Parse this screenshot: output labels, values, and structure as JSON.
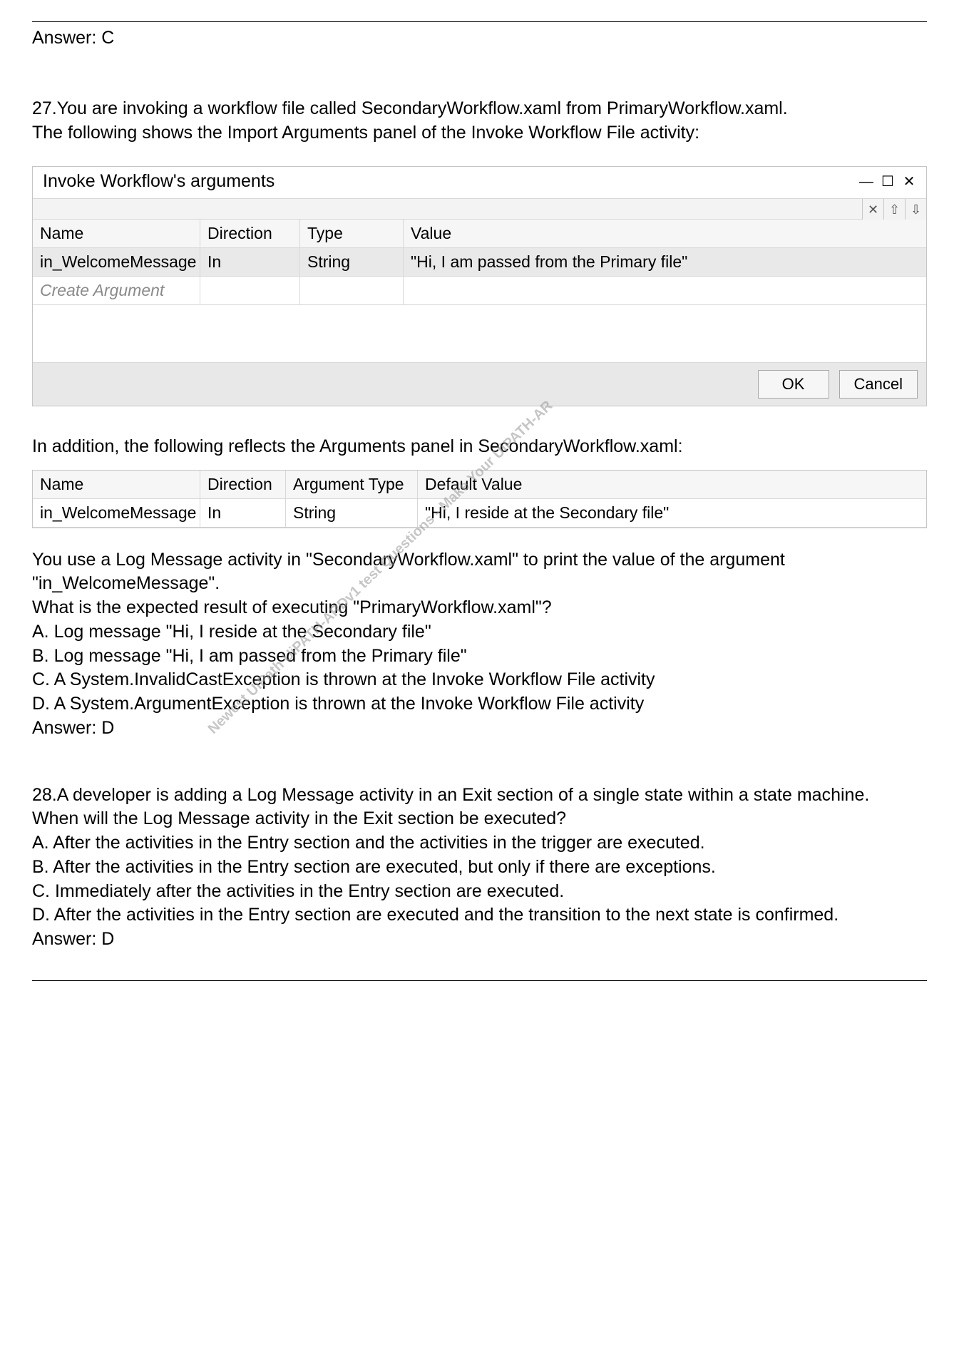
{
  "prev_answer": "Answer: C",
  "q27": {
    "intro1": "27.You are invoking a workflow file called SecondaryWorkflow.xaml from PrimaryWorkflow.xaml.",
    "intro2": "The following shows the Import Arguments panel of the Invoke Workflow File activity:",
    "dialog_title": "Invoke Workflow's arguments",
    "header_name": "Name",
    "header_dir": "Direction",
    "header_type": "Type",
    "header_value": "Value",
    "row1_name": "in_WelcomeMessage",
    "row1_dir": "In",
    "row1_type": "String",
    "row1_value": "\"Hi, I am passed from the Primary file\"",
    "create_arg": "Create Argument",
    "btn_ok": "OK",
    "btn_cancel": "Cancel",
    "mid": "In addition, the following reflects the Arguments panel in SecondaryWorkflow.xaml:",
    "ap_h_name": "Name",
    "ap_h_dir": "Direction",
    "ap_h_type": "Argument Type",
    "ap_h_val": "Default Value",
    "ap_r_name": "in_WelcomeMessage",
    "ap_r_dir": "In",
    "ap_r_type": "String",
    "ap_r_val": "\"Hi, I reside at the Secondary file\"",
    "after1": "You use a Log Message activity in \"SecondaryWorkflow.xaml\" to print the value of the argument \"in_WelcomeMessage\".",
    "after2": "What is the expected result of executing \"PrimaryWorkflow.xaml\"?",
    "optA": "A. Log message \"Hi, I reside at the Secondary file\"",
    "optB": "B. Log message \"Hi, I am passed from the Primary file\"",
    "optC": "C. A System.InvalidCastException is thrown at the Invoke Workflow File activity",
    "optD": "D. A System.ArgumentException is thrown at the Invoke Workflow File activity",
    "answer": "Answer: D"
  },
  "watermark": "Newest UiPath UiPATH-ARDv1 test Questions - Make Your UiPATH-AR",
  "q28": {
    "intro1": "28.A developer is adding a Log Message activity in an Exit section of a single state within a state machine.",
    "intro2": "When will the Log Message activity in the Exit section be executed?",
    "optA": "A. After the activities in the Entry section and the activities in the trigger are executed.",
    "optB": "B. After the activities in the Entry section are executed, but only if there are exceptions.",
    "optC": "C. Immediately after the activities in the Entry section are executed.",
    "optD": "D. After the activities in the Entry section are executed and the transition to the next state is confirmed.",
    "answer": "Answer: D"
  }
}
